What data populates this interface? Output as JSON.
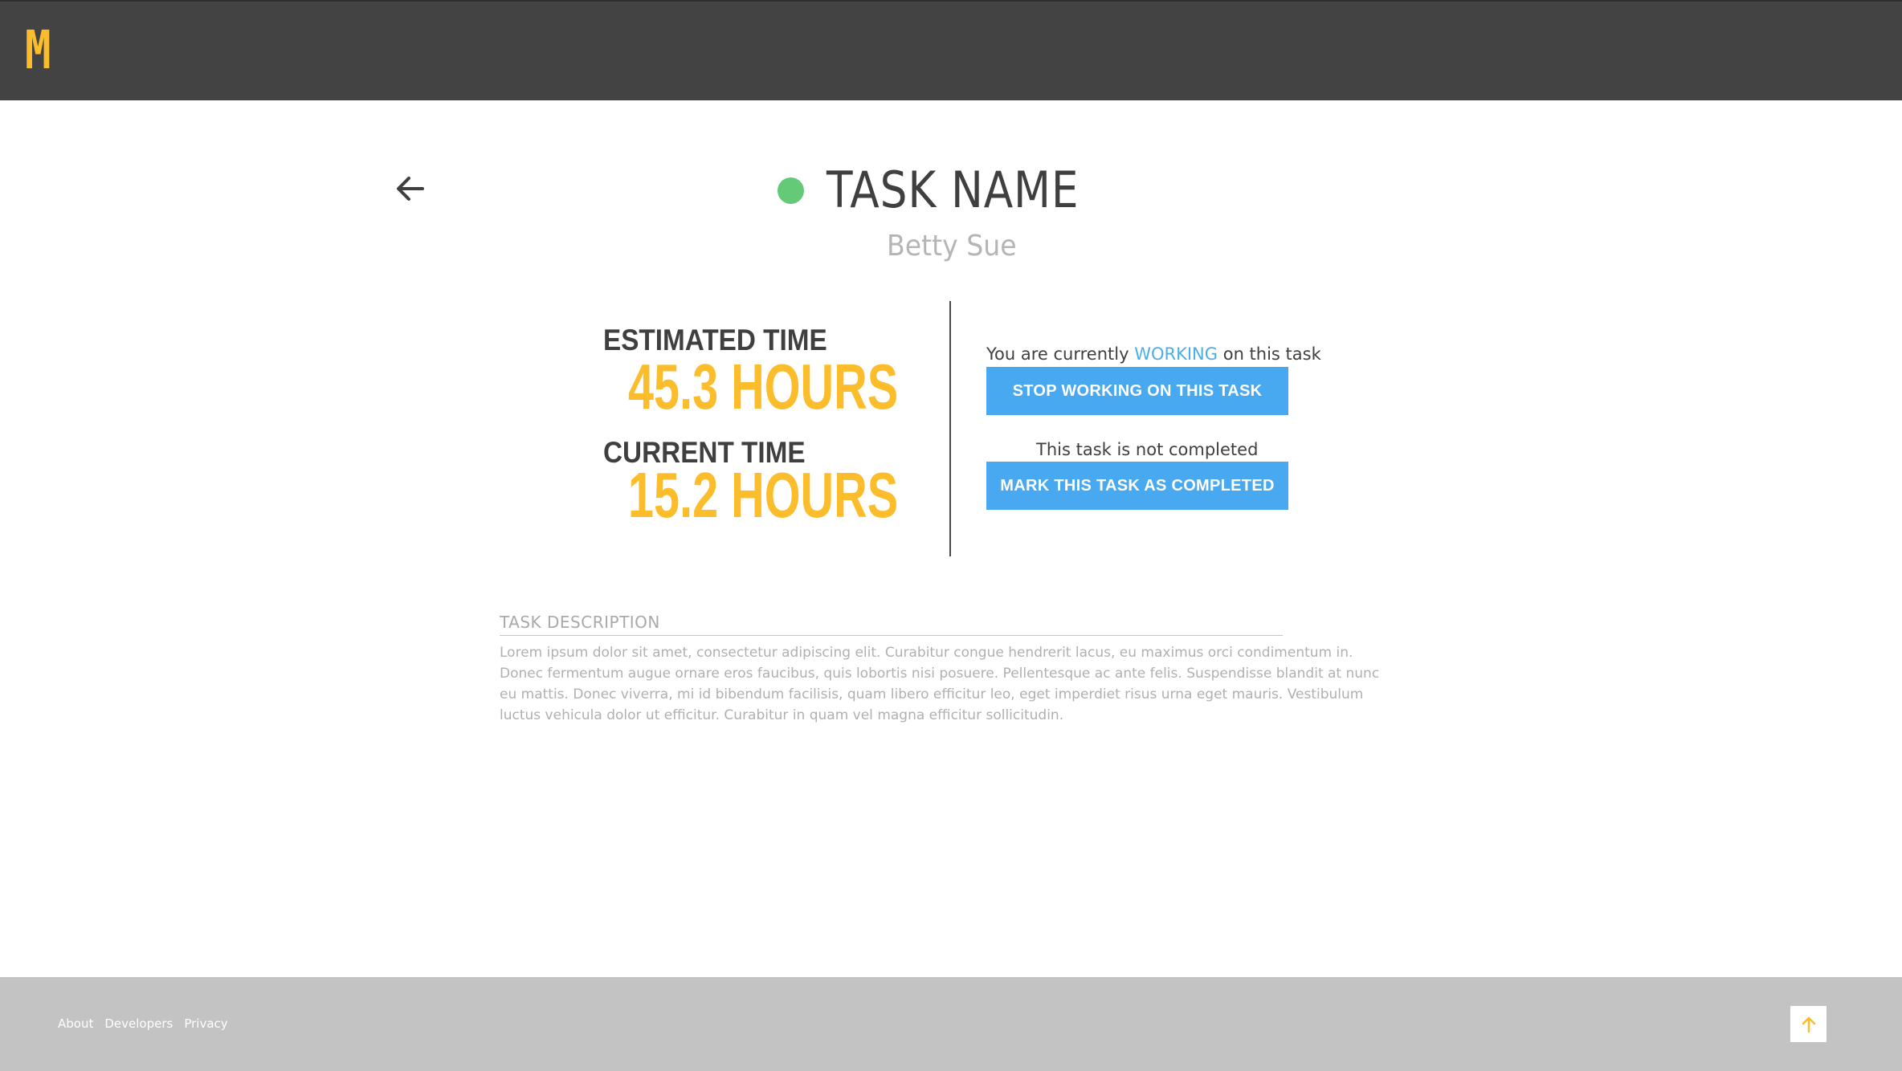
{
  "header": {
    "logo_text": "M",
    "logo_color": "#fbbd2c",
    "background": "#434343"
  },
  "nav": {
    "back_icon": "arrow-left-icon"
  },
  "task": {
    "status_color": "#65ca77",
    "title": "TASK NAME",
    "assignee": "Betty Sue"
  },
  "times": {
    "estimated_label": "ESTIMATED TIME",
    "estimated_value": "45.3 HOURS",
    "current_label": "CURRENT TIME",
    "current_value": "15.2 HOURS"
  },
  "work_status": {
    "prefix": "You are currently ",
    "state": "WORKING",
    "suffix": " on this task",
    "button_label": "STOP WORKING ON THIS TASK"
  },
  "completion": {
    "status_text": "This task is not completed",
    "button_label": "MARK THIS TASK AS COMPLETED"
  },
  "description": {
    "header": "TASK DESCRIPTION",
    "body": "Lorem ipsum dolor sit amet, consectetur adipiscing elit. Curabitur congue hendrerit lacus, eu maximus orci condimentum in. Donec fermentum augue ornare eros faucibus, quis lobortis nisi posuere. Pellentesque ac ante felis. Suspendisse blandit at nunc eu mattis. Donec viverra, mi id bibendum facilisis, quam libero efficitur leo, eget imperdiet risus urna eget mauris. Vestibulum luctus vehicula dolor ut efficitur. Curabitur in quam vel magna efficitur sollicitudin."
  },
  "footer": {
    "links": [
      "About",
      "Developers",
      "Privacy"
    ],
    "to_top_icon": "arrow-up-icon"
  },
  "colors": {
    "accent_yellow": "#fbbd2c",
    "button_blue": "#49a9f0",
    "working_blue": "#4aaee8",
    "status_green": "#65ca77"
  }
}
